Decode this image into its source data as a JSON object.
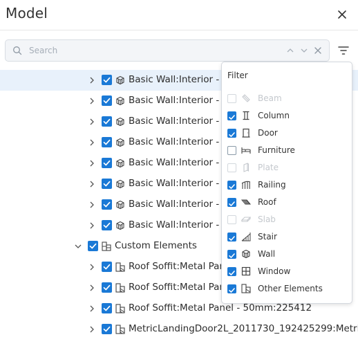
{
  "window": {
    "title": "Model"
  },
  "search": {
    "placeholder": "Search",
    "value": ""
  },
  "tree": {
    "rows": [
      {
        "label": "Basic Wall:Interior - 1",
        "selected": true
      },
      {
        "label": "Basic Wall:Interior - 1"
      },
      {
        "label": "Basic Wall:Interior - 1"
      },
      {
        "label": "Basic Wall:Interior - 1"
      },
      {
        "label": "Basic Wall:Interior - 1"
      },
      {
        "label": "Basic Wall:Interior - 1"
      },
      {
        "label": "Basic Wall:Interior - 1"
      },
      {
        "label": "Basic Wall:Interior - 1"
      },
      {
        "label": "Custom Elements"
      },
      {
        "label": "Roof Soffit:Metal Pan"
      },
      {
        "label": "Roof Soffit:Metal Pan"
      },
      {
        "label": "Roof Soffit:Metal Panel - 50mm:225412"
      },
      {
        "label": "MetricLandingDoor2L_2011730_192425299:Metri..."
      }
    ]
  },
  "filter": {
    "title": "Filter",
    "items": [
      {
        "label": "Beam",
        "state": "disabled",
        "icon": "beam-icon"
      },
      {
        "label": "Column",
        "state": "checked",
        "icon": "column-icon"
      },
      {
        "label": "Door",
        "state": "checked",
        "icon": "door-icon"
      },
      {
        "label": "Furniture",
        "state": "unchecked",
        "icon": "furniture-icon"
      },
      {
        "label": "Plate",
        "state": "disabled",
        "icon": "plate-icon"
      },
      {
        "label": "Railing",
        "state": "checked",
        "icon": "railing-icon"
      },
      {
        "label": "Roof",
        "state": "checked",
        "icon": "roof-icon"
      },
      {
        "label": "Slab",
        "state": "disabled",
        "icon": "slab-icon"
      },
      {
        "label": "Stair",
        "state": "checked",
        "icon": "stair-icon"
      },
      {
        "label": "Wall",
        "state": "checked",
        "icon": "wall-icon"
      },
      {
        "label": "Window",
        "state": "checked",
        "icon": "window-icon"
      },
      {
        "label": "Other Elements",
        "state": "checked",
        "icon": "other-elements-icon"
      }
    ]
  },
  "colors": {
    "accent": "#1a79d6",
    "selected_row": "#e8f1fb",
    "search_bg": "#f3f5f8"
  }
}
